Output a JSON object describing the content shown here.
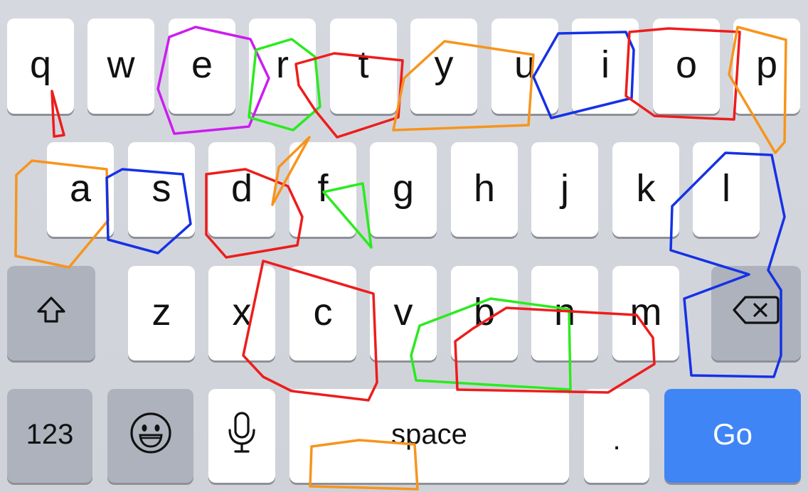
{
  "keyboard": {
    "row1": [
      "q",
      "w",
      "e",
      "r",
      "t",
      "y",
      "u",
      "i",
      "o",
      "p"
    ],
    "row2": [
      "a",
      "s",
      "d",
      "f",
      "g",
      "h",
      "j",
      "k",
      "l"
    ],
    "row3": [
      "z",
      "x",
      "c",
      "v",
      "b",
      "n",
      "m"
    ],
    "row4": {
      "numbers_label": "123",
      "space_label": "space",
      "period_label": ".",
      "go_label": "Go"
    },
    "icons": {
      "shift": "shift-arrow-icon",
      "backspace": "backspace-icon",
      "emoji": "smiley-face-icon",
      "mic": "microphone-icon"
    }
  },
  "colors": {
    "key_bg": "#ffffff",
    "dark_key_bg": "#adb2bc",
    "keyboard_bg": "#d1d4db",
    "go_button": "#3f85f5",
    "annotation_red": "#ee1c1c",
    "annotation_orange": "#f7941d",
    "annotation_blue": "#1531e6",
    "annotation_green": "#2bea1f",
    "annotation_magenta": "#cc1cf0"
  }
}
